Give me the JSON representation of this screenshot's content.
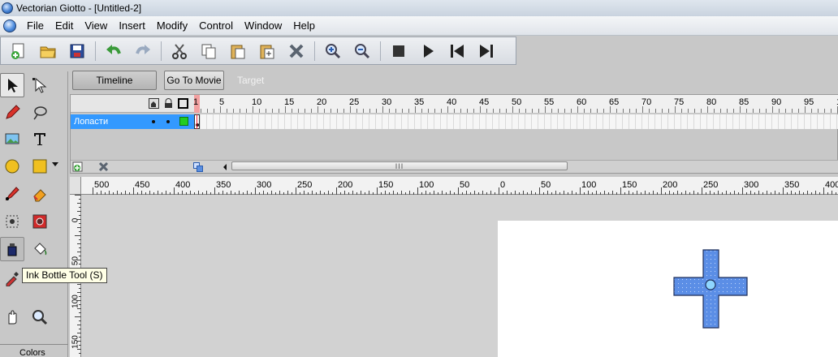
{
  "window": {
    "title": "Vectorian Giotto - [Untitled-2]"
  },
  "menu": {
    "items": [
      "File",
      "Edit",
      "View",
      "Insert",
      "Modify",
      "Control",
      "Window",
      "Help"
    ]
  },
  "toolbar": {
    "icons": [
      "new-document-icon",
      "open-folder-icon",
      "save-icon",
      "undo-icon",
      "redo-icon",
      "cut-icon",
      "copy-icon",
      "paste-icon",
      "paste-in-place-icon",
      "delete-icon",
      "zoom-in-icon",
      "zoom-out-icon",
      "stop-icon",
      "play-icon",
      "rewind-icon",
      "step-forward-icon"
    ]
  },
  "tools": {
    "items": [
      "arrow-tool-icon",
      "subselect-tool-icon",
      "pencil-tool-icon",
      "lasso-tool-icon",
      "image-tool-icon",
      "text-tool-icon",
      "oval-tool-icon",
      "rectangle-tool-icon",
      "brush-tool-icon",
      "eraser-tool-icon",
      "transform-tool-icon",
      "fill-transform-tool-icon",
      "ink-bottle-tool-icon",
      "paint-bucket-tool-icon",
      "eyedropper-tool-icon",
      "hand-tool-icon",
      "zoom-tool-icon"
    ],
    "tooltip": "Ink Bottle Tool (S)",
    "colors_label": "Colors"
  },
  "timeline_bar": {
    "timeline_label": "Timeline",
    "goto_movie_label": "Go To Movie",
    "target_label": "Target"
  },
  "timeline": {
    "frame_numbers": [
      "1",
      "5",
      "10",
      "15",
      "20",
      "25",
      "30",
      "35",
      "40",
      "45",
      "50",
      "55",
      "60",
      "65",
      "70",
      "75",
      "80",
      "85",
      "90",
      "95",
      "10"
    ],
    "layer": {
      "name": "Лопасти",
      "color": "#22cc22"
    },
    "current_frame": 1
  },
  "stage": {
    "h_ruler_labels": [
      "500",
      "450",
      "400",
      "350",
      "300",
      "250",
      "200",
      "150",
      "100",
      "50",
      "0",
      "50",
      "100",
      "150",
      "200",
      "250",
      "300",
      "350",
      "400"
    ],
    "v_ruler_labels": [
      "0",
      "50",
      "100",
      "150"
    ],
    "shape_fill": "#5b8ee6"
  }
}
